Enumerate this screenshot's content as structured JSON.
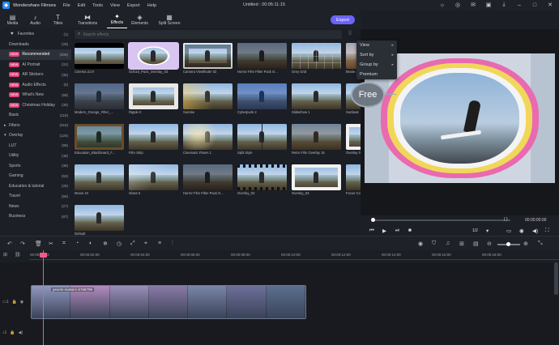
{
  "app": {
    "name": "Wondershare Filmora",
    "window_title": "Untitled : 00:05:11:15",
    "menu": [
      "File",
      "Edit",
      "Tools",
      "View",
      "Export",
      "Help"
    ]
  },
  "tabs": [
    {
      "label": "Media",
      "icon": "folder-icon",
      "glyph": "▤"
    },
    {
      "label": "Audio",
      "icon": "music-icon",
      "glyph": "♪"
    },
    {
      "label": "Titles",
      "icon": "text-icon",
      "glyph": "T"
    },
    {
      "label": "Transitions",
      "icon": "transition-icon",
      "glyph": "⧓"
    },
    {
      "label": "Effects",
      "icon": "effects-icon",
      "glyph": "✦",
      "active": true
    },
    {
      "label": "Elements",
      "icon": "elements-icon",
      "glyph": "◈"
    },
    {
      "label": "Split Screen",
      "icon": "split-screen-icon",
      "glyph": "▦"
    }
  ],
  "export_label": "Export",
  "search": {
    "placeholder": "Search effects"
  },
  "categories": [
    {
      "label": "Favorites",
      "count": "(1)",
      "arrow": "",
      "chip": "♥",
      "chip_color": ""
    },
    {
      "label": "Downloads",
      "count": "(29)",
      "arrow": "",
      "chip": "",
      "chip_color": ""
    },
    {
      "label": "Recommended",
      "count": "(300)",
      "arrow": "",
      "chip": "NEW",
      "chip_color": "#e0457b",
      "selected": true
    },
    {
      "label": "AI Portrait",
      "count": "(31)",
      "arrow": "",
      "chip": "NEW",
      "chip_color": "#e0457b"
    },
    {
      "label": "AR Stickers",
      "count": "(36)",
      "arrow": "",
      "chip": "NEW",
      "chip_color": "#e0457b"
    },
    {
      "label": "Audio Effects",
      "count": "(9)",
      "arrow": "",
      "chip": "NEW",
      "chip_color": "#e0457b"
    },
    {
      "label": "What's New",
      "count": "(58)",
      "arrow": "",
      "chip": "NEW",
      "chip_color": "#e0457b"
    },
    {
      "label": "Christmas Holiday",
      "count": "(39)",
      "arrow": "",
      "chip": "NEW",
      "chip_color": "#e0457b"
    },
    {
      "label": "Basic",
      "count": "(118)",
      "arrow": "",
      "chip": "",
      "chip_color": ""
    },
    {
      "label": "Filters",
      "count": "(316)",
      "arrow": "▸",
      "chip": "",
      "chip_color": ""
    },
    {
      "label": "Overlay",
      "count": "(120)",
      "arrow": "▾",
      "chip": "",
      "chip_color": ""
    },
    {
      "label": "LUT",
      "count": "(99)",
      "arrow": "",
      "chip": "",
      "chip_color": ""
    },
    {
      "label": "Utility",
      "count": "(49)",
      "arrow": "",
      "chip": "",
      "chip_color": ""
    },
    {
      "label": "Sports",
      "count": "(38)",
      "arrow": "",
      "chip": "",
      "chip_color": ""
    },
    {
      "label": "Gaming",
      "count": "(53)",
      "arrow": "",
      "chip": "",
      "chip_color": ""
    },
    {
      "label": "Education & tutorial",
      "count": "(25)",
      "arrow": "",
      "chip": "",
      "chip_color": ""
    },
    {
      "label": "Travel",
      "count": "(69)",
      "arrow": "",
      "chip": "",
      "chip_color": ""
    },
    {
      "label": "News",
      "count": "(27)",
      "arrow": "",
      "chip": "",
      "chip_color": ""
    },
    {
      "label": "Business",
      "count": "(87)",
      "arrow": "",
      "chip": "",
      "chip_color": ""
    }
  ],
  "effects": [
    {
      "name": "Cinema 21:9",
      "overlay": "cinema"
    },
    {
      "name": "School_Pack_Overlay_03",
      "overlay": "cloud",
      "selected": true
    },
    {
      "name": "Camera Viewfinder 02",
      "overlay": "viewfinder"
    },
    {
      "name": "Horror Film Filter Pack O...",
      "overlay": "dark"
    },
    {
      "name": "Grey Grid",
      "overlay": "grid"
    },
    {
      "name": "Movie 3",
      "overlay": "warm"
    },
    {
      "name": "Modern_Grunge_Filter_...",
      "overlay": "grunge"
    },
    {
      "name": "Ripple 0",
      "overlay": "frame"
    },
    {
      "name": "Sunrise",
      "overlay": "sunrise"
    },
    {
      "name": "Cyberpunk 2",
      "overlay": "cyber"
    },
    {
      "name": "Slideshow 1",
      "overlay": "plain"
    },
    {
      "name": "Sunbeat",
      "overlay": "plain"
    },
    {
      "name": "Education_Blackboard_F...",
      "overlay": "board"
    },
    {
      "name": "Film Strip",
      "overlay": "plain"
    },
    {
      "name": "Cinematic Flares 1",
      "overlay": "flare"
    },
    {
      "name": "Split Style",
      "overlay": "split"
    },
    {
      "name": "Retro Film Overlay 15",
      "overlay": "retro"
    },
    {
      "name": "Overlay 03",
      "overlay": "white"
    },
    {
      "name": "Movie 10",
      "overlay": "plain"
    },
    {
      "name": "Glass 5",
      "overlay": "glass"
    },
    {
      "name": "Horror Film Filter Pack O...",
      "overlay": "dark"
    },
    {
      "name": "Overlay_04",
      "overlay": "filmstrip"
    },
    {
      "name": "Overlay_03",
      "overlay": "white"
    },
    {
      "name": "Focus Color",
      "overlay": "plain"
    },
    {
      "name": "Default",
      "overlay": "plain"
    }
  ],
  "dropdown": {
    "items": [
      {
        "label": "View",
        "arrow": "▸"
      },
      {
        "label": "Sort by",
        "arrow": "▸"
      },
      {
        "label": "Group by",
        "arrow": "▸"
      },
      {
        "label": "Premium",
        "arrow": ""
      }
    ],
    "badge": "Free"
  },
  "player": {
    "current_time": "00:00:00:00",
    "zoom": "1/2",
    "progress": 0.0
  },
  "timeline": {
    "ticks": [
      "00:00:00:00",
      "00:00:02:00",
      "00:00:04:00",
      "00:00:06:00",
      "00:00:08:00",
      "00:00:10:00",
      "00:00:12:00",
      "00:00:14:00",
      "00:00:16:00",
      "00:00:18:00"
    ],
    "clip_label": "pexels-maksim-5768799",
    "clip_frames": 7,
    "zoom_level": 0.4
  },
  "colors": {
    "accent": "#6c63ff",
    "playhead": "#f05a88",
    "new_chip": "#e0457b"
  }
}
